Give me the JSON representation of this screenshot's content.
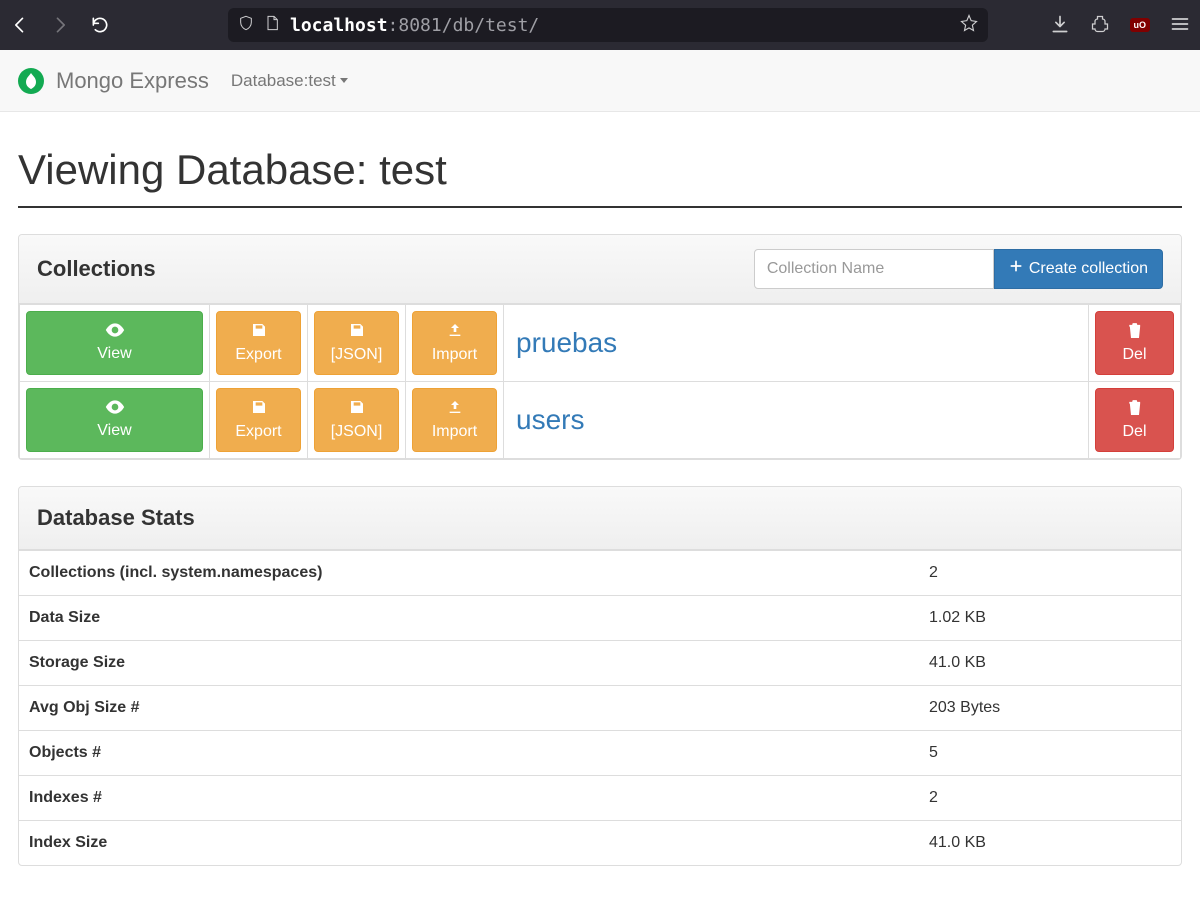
{
  "browser": {
    "url_host": "localhost",
    "url_path": ":8081/db/test/"
  },
  "navbar": {
    "brand": "Mongo Express",
    "crumb_prefix": "Database: ",
    "db_name": "test"
  },
  "page": {
    "title": "Viewing Database: test"
  },
  "collections_panel": {
    "title": "Collections",
    "input_placeholder": "Collection Name",
    "create_label": "Create collection"
  },
  "action_labels": {
    "view": "View",
    "export": "Export",
    "json": "[JSON]",
    "import": "Import",
    "del": "Del"
  },
  "collections": [
    {
      "name": "pruebas"
    },
    {
      "name": "users"
    }
  ],
  "stats_panel": {
    "title": "Database Stats"
  },
  "stats": [
    {
      "label": "Collections (incl. system.namespaces)",
      "value": "2"
    },
    {
      "label": "Data Size",
      "value": "1.02 KB"
    },
    {
      "label": "Storage Size",
      "value": "41.0 KB"
    },
    {
      "label": "Avg Obj Size #",
      "value": "203 Bytes"
    },
    {
      "label": "Objects #",
      "value": "5"
    },
    {
      "label": "Indexes #",
      "value": "2"
    },
    {
      "label": "Index Size",
      "value": "41.0 KB"
    }
  ]
}
